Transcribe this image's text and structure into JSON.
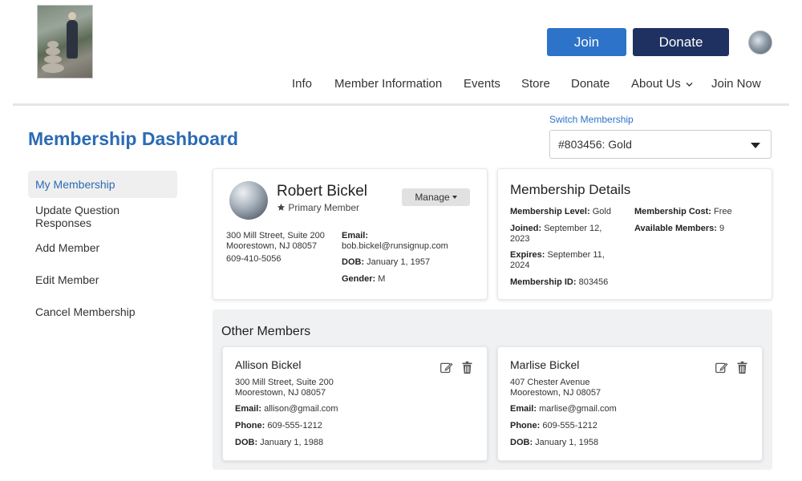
{
  "header": {
    "join_label": "Join",
    "donate_label": "Donate",
    "nav": [
      "Info",
      "Member Information",
      "Events",
      "Store",
      "Donate",
      "About Us",
      "Join Now"
    ]
  },
  "page": {
    "title": "Membership Dashboard",
    "switch_label": "Switch Membership",
    "selected_membership": "#803456: Gold"
  },
  "sidebar": {
    "items": [
      {
        "label": "My Membership",
        "active": true
      },
      {
        "label": "Update Question Responses"
      },
      {
        "label": "Add Member"
      },
      {
        "label": "Edit Member"
      },
      {
        "label": "Cancel Membership"
      }
    ]
  },
  "primary_member": {
    "name": "Robert Bickel",
    "role": "Primary Member",
    "manage_label": "Manage",
    "address_line1": "300 Mill Street, Suite 200",
    "address_line2": "Moorestown, NJ 08057",
    "phone": "609-410-5056",
    "email_label": "Email:",
    "email": "bob.bickel@runsignup.com",
    "dob_label": "DOB:",
    "dob": "January 1, 1957",
    "gender_label": "Gender:",
    "gender": "M"
  },
  "membership_details": {
    "title": "Membership Details",
    "level_label": "Membership Level:",
    "level": "Gold",
    "joined_label": "Joined:",
    "joined": "September 12, 2023",
    "expires_label": "Expires:",
    "expires": "September 11, 2024",
    "id_label": "Membership ID:",
    "id": "803456",
    "cost_label": "Membership Cost:",
    "cost": "Free",
    "available_label": "Available Members:",
    "available": "9"
  },
  "other_members": {
    "title": "Other Members",
    "members": [
      {
        "name": "Allison Bickel",
        "address_line1": "300 Mill Street, Suite 200",
        "address_line2": "Moorestown, NJ 08057",
        "email_label": "Email:",
        "email": "allison@gmail.com",
        "phone_label": "Phone:",
        "phone": "609-555-1212",
        "dob_label": "DOB:",
        "dob": "January 1, 1988"
      },
      {
        "name": "Marlise Bickel",
        "address_line1": "407 Chester Avenue",
        "address_line2": "Moorestown, NJ 08057",
        "email_label": "Email:",
        "email": "marlise@gmail.com",
        "phone_label": "Phone:",
        "phone": "609-555-1212",
        "dob_label": "DOB:",
        "dob": "January 1, 1958"
      }
    ]
  },
  "colors": {
    "primary_blue": "#2c73c9",
    "title_blue": "#2c6bb3",
    "navy": "#1e3160",
    "gray_panel": "#f0f1f3"
  },
  "icons": [
    "edit-icon",
    "trash-icon",
    "star-icon",
    "chevron-down-icon",
    "caret-down-icon"
  ]
}
